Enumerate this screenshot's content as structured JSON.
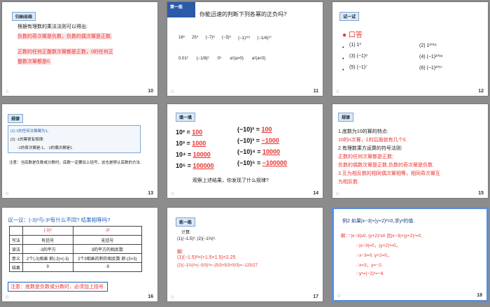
{
  "slides": [
    {
      "num": "10",
      "tag": "归纳总结",
      "lines": [
        "根据有理数的乘法法则可以得出:",
        "负数的奇次幂是负数，负数的偶次幂是正数.",
        "正数的任何正整数次幂都是正数，0的任何正",
        "整数次幂都是0."
      ]
    },
    {
      "num": "11",
      "tag": "第一练",
      "title": "你能迅速的判断下列各幂的正负吗?",
      "row1": [
        "16⁵",
        "25⁴",
        "(−7)⁸",
        "(−3)⁵",
        "(−1)¹⁰¹",
        "(−1/4)¹⁰"
      ],
      "row2": [
        "0.01²",
        "(−1/8)²",
        "0⁵",
        "a²(a>0)",
        "a²(a<0)"
      ]
    },
    {
      "num": "12",
      "tag": "试一试",
      "heading": "口答",
      "items": [
        "(1) 1³",
        "(2) 1²⁰¹⁸",
        "(3) (−1)⁸",
        "(4) (−1)²⁰¹⁸",
        "(5) (−1)⁷",
        "(6) (−1)²⁰¹⁷"
      ]
    },
    {
      "num": "13",
      "tag": "规律",
      "lines": [
        "(1) 1的任何次幂都为1;",
        "(2) -1的幂很有规律:",
        "-1的奇次幂是-1，-1的偶次幂是1."
      ],
      "note": "注意：当底数是负数或分数时，底数一定要加上括号，这也是辨认底数的方法."
    },
    {
      "num": "14",
      "tag": "填一填",
      "left": [
        [
          "10²",
          "100"
        ],
        [
          "10³",
          "1000"
        ],
        [
          "10⁴",
          "10000"
        ],
        [
          "10⁵",
          "100000"
        ]
      ],
      "right": [
        [
          "(−10)²",
          "100"
        ],
        [
          "(−10)³",
          "−1000"
        ],
        [
          "(−10)⁴",
          "10000"
        ],
        [
          "(−10)⁵",
          "−100000"
        ]
      ],
      "question": "观察上述结果，你发现了什么规律?"
    },
    {
      "num": "15",
      "tag": "规律",
      "lines": [
        "1.底数为10的幂的特点:",
        "10的n次幂，1的后面就有几个0.",
        "2.有理数乘方运算的符号法则:",
        "正数的任何次幂都是正数;",
        "负数的偶数次幂是正数,负数的奇次幂是负数.",
        "3.互为相反数的相同偶次幂相等，相同奇次幂互",
        "为相反数."
      ]
    },
    {
      "num": "16",
      "question": "议一议：(-3)²与-3²有什么不同? 结果相等吗?",
      "col1": "(-3)²",
      "col2": "-3²",
      "rows": [
        [
          "写法",
          "有括号",
          "无括号"
        ],
        [
          "读法",
          "-3的平方",
          "3的平方的相反数"
        ],
        [
          "意义",
          "2个(-3)相乘 即(-3)×(-3)",
          "2个3相乘的积的相反数 即-(3×3)"
        ],
        [
          "结果",
          "9",
          "-9"
        ]
      ],
      "note": "注意：底数是负数或分数时，必须加上括号."
    },
    {
      "num": "17",
      "tag": "练一练",
      "task": "计算:",
      "exprs": "(1)(−1.5)²;  (2)(−1⅔)³.",
      "sol": "解:",
      "s1": "(1)(−1.5)²=(+1.5×1.5)=2.25",
      "s2": "(2)(−1⅔)³=(−5/3)³=−(5/3×5/3×5/3)=−125/27"
    },
    {
      "num": "18",
      "example": "例2  如果|x−3|+(y+2)²=0,求yˣ的值.",
      "sol": [
        "解: ∵|x−3|≥0, (y+2)²≥0 且|x−3|+(y+2)²=0,",
        "∴|x−3|=0，(y+2)²=0，",
        "∴x−3=0, y+2=0，",
        "∴x=3，y=−2.",
        "∴yˣ=(−2)³=−8."
      ]
    }
  ],
  "star": "☆"
}
